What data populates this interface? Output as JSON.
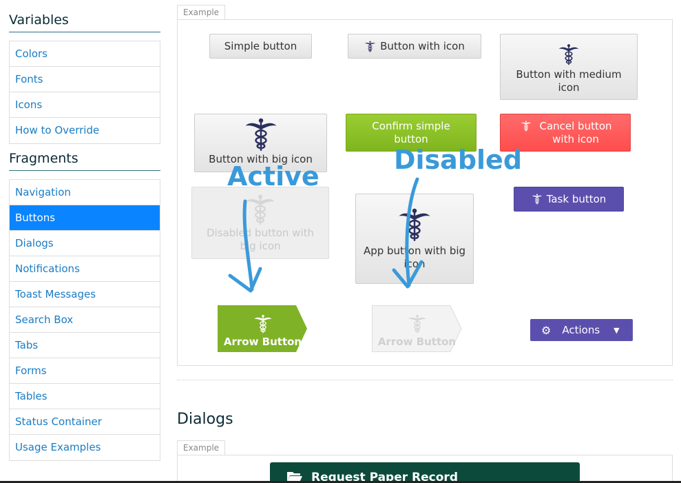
{
  "sidebar": {
    "variables_title": "Variables",
    "variables_items": [
      "Colors",
      "Fonts",
      "Icons",
      "How to Override"
    ],
    "fragments_title": "Fragments",
    "fragments_items": [
      "Navigation",
      "Buttons",
      "Dialogs",
      "Notifications",
      "Toast Messages",
      "Search Box",
      "Tabs",
      "Forms",
      "Tables",
      "Status Container",
      "Usage Examples"
    ],
    "active_item": "Buttons"
  },
  "example": {
    "tab_label": "Example",
    "buttons": {
      "simple": "Simple button",
      "with_icon": "Button with icon",
      "medium_icon": "Button with medium icon",
      "big_icon": "Button with big icon",
      "confirm": "Confirm simple button",
      "cancel": "Cancel button with icon",
      "task": "Task button",
      "disabled_big": "Disabled button with big icon",
      "app_big": "App button with big icon",
      "arrow_active": "Arrow Button",
      "arrow_disabled": "Arrow Button",
      "actions": "Actions"
    },
    "icon": "caduceus-icon"
  },
  "annotations": {
    "active": "Active",
    "disabled": "Disabled"
  },
  "dialogs": {
    "heading": "Dialogs",
    "tab_label": "Example",
    "dialog_title": "Request Paper Record"
  },
  "colors": {
    "accent_blue": "#0a84ff",
    "green": "#8bc34a",
    "red": "#ff4d4d",
    "purple": "#5b4fad",
    "annotation": "#3a9ad9",
    "dialog_header": "#0c4a3c"
  }
}
